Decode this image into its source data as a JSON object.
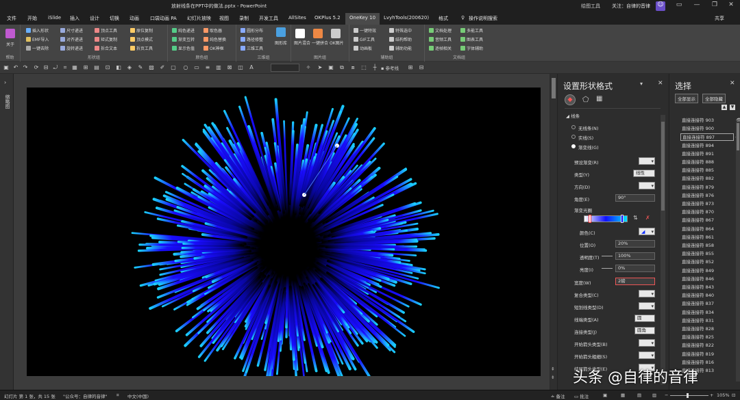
{
  "titlebar": {
    "title": "放射线条在PPT中的做法.pptx  -  PowerPoint",
    "drawing_tools": "绘图工具",
    "follow": "关注：自律的音律",
    "icons": [
      "avatar-icon",
      "ribbon-display-icon",
      "minimize-icon",
      "restore-icon",
      "close-icon"
    ]
  },
  "tabs": [
    "文件",
    "开始",
    "iSlide",
    "插入",
    "设计",
    "切换",
    "动画",
    "口袋动画 PA",
    "幻灯片放映",
    "视图",
    "录制",
    "开发工具",
    "AllSites",
    "OKPlus 5.2",
    "OneKey 10",
    "LvyhTools(200620)",
    "格式",
    "操作说明搜索"
  ],
  "share": "共享",
  "ribbon": {
    "about": "关于",
    "about_group": "帮助",
    "shape_items": [
      "插入形状",
      "EMF导入",
      "一键去除",
      "尺寸递进",
      "对齐递进",
      "旋转递进",
      "顶点工具",
      "矩式复制",
      "拆合文本",
      "原位复制",
      "顶点模式",
      "拆页工具"
    ],
    "shape_group": "形状组",
    "color_items": [
      "纯色递进",
      "渐变互转",
      "显示色值",
      "取色器",
      "纯色替换",
      "OK神框"
    ],
    "color_group": "颜色组",
    "three_items": [
      "圆形分布",
      "路径修整",
      "三维工具",
      "两形变换"
    ],
    "three_label": "图形库",
    "three_group": "三维组",
    "image_items": [
      "图片混合",
      "一键拼合",
      "OK图片"
    ],
    "image_group": "图片组",
    "assist_items": [
      "一键特效",
      "GIF工具",
      "动画板",
      "特殊选中",
      "结构帮助",
      "辅助功能"
    ],
    "assist_group": "辅助组",
    "doc_items": [
      "文档处理",
      "音频工具",
      "逐帧相关",
      "多能工具",
      "图表工具",
      "字体辅助"
    ],
    "doc_group": "文档组"
  },
  "format_pane": {
    "title": "设置形状格式",
    "section": "线条",
    "radios": [
      "无线条(N)",
      "实线(S)",
      "渐变线(G)"
    ],
    "selected_radio": "渐变线(G)",
    "fields": [
      {
        "label": "预设渐变(R)",
        "value": ""
      },
      {
        "label": "类型(Y)",
        "value": "线性"
      },
      {
        "label": "方向(D)",
        "value": ""
      },
      {
        "label": "角度(E)",
        "value": "90°"
      },
      {
        "label": "渐变光圈",
        "value": ""
      },
      {
        "label": "颜色(C)",
        "value": ""
      },
      {
        "label": "位置(O)",
        "value": "20%"
      },
      {
        "label": "透明度(T)",
        "value": "100%"
      },
      {
        "label": "亮度(I)",
        "value": "0%"
      },
      {
        "label": "宽度(W)",
        "value": "2磅"
      },
      {
        "label": "复合类型(C)",
        "value": ""
      },
      {
        "label": "短划线类型(D)",
        "value": ""
      },
      {
        "label": "线端类型(A)",
        "value": "圆"
      },
      {
        "label": "连接类型(J)",
        "value": "圆角"
      },
      {
        "label": "开始箭头类型(B)",
        "value": ""
      },
      {
        "label": "开始箭头粗细(S)",
        "value": ""
      },
      {
        "label": "结尾箭头类型(E)",
        "value": ""
      }
    ],
    "gradient_colors": [
      "#ffffff",
      "#1010ff",
      "#00e5ff"
    ]
  },
  "select_pane": {
    "title": "选择",
    "show_all": "全部显示",
    "hide_all": "全部隐藏",
    "items": [
      "直接连接符 903",
      "直接连接符 900",
      "直接连接符 897",
      "直接连接符 894",
      "直接连接符 891",
      "直接连接符 888",
      "直接连接符 885",
      "直接连接符 882",
      "直接连接符 879",
      "直接连接符 876",
      "直接连接符 873",
      "直接连接符 870",
      "直接连接符 867",
      "直接连接符 864",
      "直接连接符 861",
      "直接连接符 858",
      "直接连接符 855",
      "直接连接符 852",
      "直接连接符 849",
      "直接连接符 846",
      "直接连接符 843",
      "直接连接符 840",
      "直接连接符 837",
      "直接连接符 834",
      "直接连接符 831",
      "直接连接符 828",
      "直接连接符 825",
      "直接连接符 822",
      "直接连接符 819",
      "直接连接符 816",
      "直接连接符 813"
    ],
    "selected_index": 2
  },
  "status": {
    "slide": "幻灯片 第 1 张，共 15 张",
    "author": "\"公众号：自律的音律\"",
    "lang": "中文(中国)",
    "notes": "备注",
    "comments": "批注",
    "zoom": "105%"
  },
  "watermark": "头条 @自律的音律",
  "colors": {
    "burst_inner": "#1a0cff",
    "burst_outer": "#1ad0ff",
    "ribbon_bg": "#444444"
  }
}
